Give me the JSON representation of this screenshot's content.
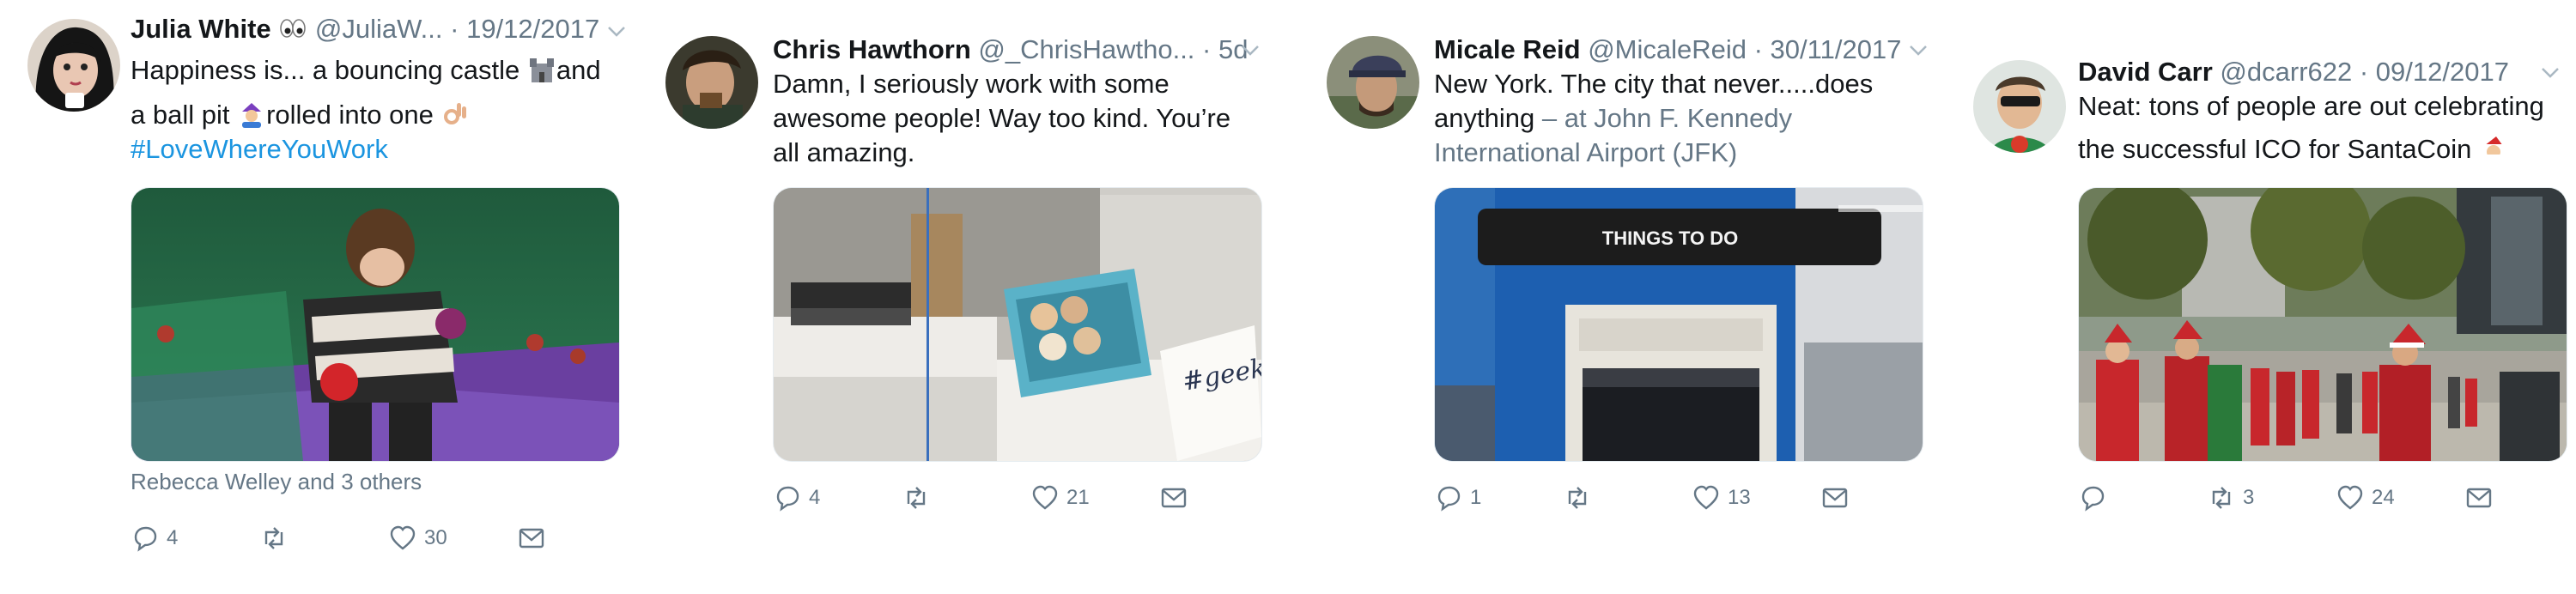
{
  "tweets": [
    {
      "name": "Julia White",
      "name_emoji_icon": "eyes-emoji",
      "handle": "@JuliaW...",
      "date": "· 19/12/2017",
      "lines": [
        "Happiness is... a bouncing castle",
        "and",
        "a ball pit",
        "rolled into one"
      ],
      "hashtag": "#LoveWhereYouWork",
      "image": "toddler-in-ball-pit-photo",
      "context": "Rebecca Welley and 3 others",
      "actions": {
        "reply": "4",
        "retweet": "",
        "like": "30"
      }
    },
    {
      "name": "Chris Hawthorn",
      "handle": "@_ChrisHawtho...",
      "date": "· 5d",
      "lines": [
        "Damn, I seriously work with some",
        "awesome people! Way too kind. You’re",
        "all amazing."
      ],
      "image": "box-of-cupcakes-geek-card-photo",
      "actions": {
        "reply": "4",
        "retweet": "",
        "like": "21"
      }
    },
    {
      "name": "Micale Reid",
      "handle": "@MicaleReid",
      "date": "· 30/11/2017",
      "lines": [
        "New York. The city that never.....does",
        "anything"
      ],
      "location_line1": "– at John F. Kennedy",
      "location_line2": "International Airport (JFK)",
      "image": "airport-kiosk-things-to-do-photo",
      "image_sign": "THINGS TO DO",
      "actions": {
        "reply": "1",
        "retweet": "",
        "like": "13"
      }
    },
    {
      "name": "David Carr",
      "handle": "@dcarr622",
      "date": "· 09/12/2017",
      "lines": [
        "Neat: tons of people are out celebrating",
        "the successful ICO for SantaCoin"
      ],
      "image": "santa-crowd-street-photo",
      "actions": {
        "reply": "",
        "retweet": "3",
        "like": "24"
      }
    }
  ],
  "icons": {
    "reply": "reply-icon",
    "retweet": "retweet-icon",
    "like": "heart-icon",
    "dm": "envelope-icon",
    "caret": "chevron-down-icon"
  },
  "colors": {
    "text": "#14171a",
    "muted": "#657786",
    "link": "#1b95e0"
  }
}
